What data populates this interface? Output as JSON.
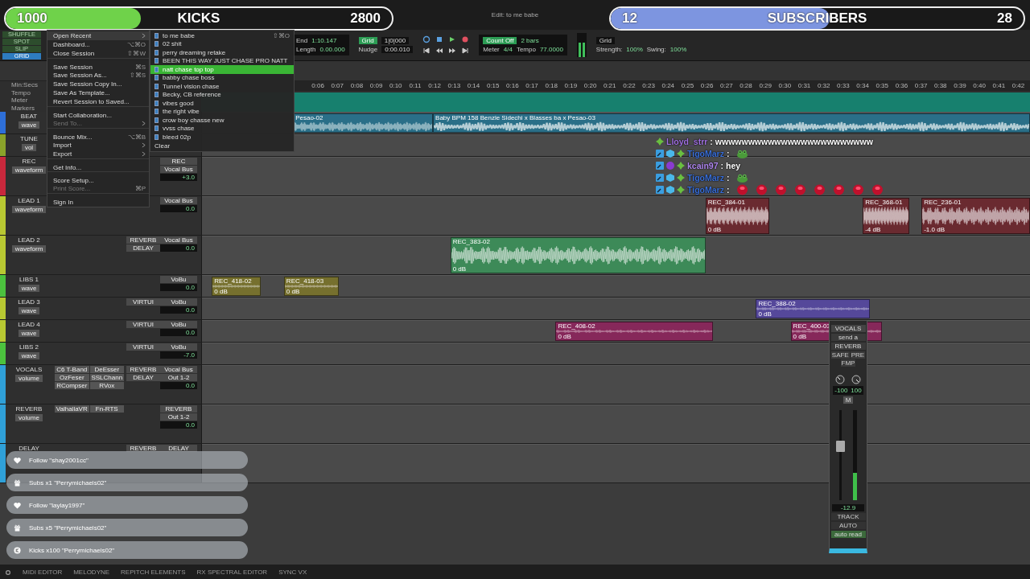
{
  "window": {
    "title": "Edit: to me babe"
  },
  "banners": [
    {
      "current": "1000",
      "label": "KICKS",
      "goal": "2800",
      "level": 0.35,
      "color": "#6fd24a"
    },
    {
      "current": "12",
      "label": "SUBSCRIBERS",
      "goal": "28",
      "level": 0.53,
      "color": "#7d95e0"
    }
  ],
  "edit_modes": [
    {
      "label": "SHUFFLE",
      "selected": false
    },
    {
      "label": "SPOT",
      "selected": false
    },
    {
      "label": "SLIP",
      "selected": false
    },
    {
      "label": "GRID",
      "selected": true
    }
  ],
  "rulers": [
    "Min:Secs",
    "Tempo",
    "Meter",
    "Markers"
  ],
  "toolbar": {
    "counters": [
      {
        "label": "End",
        "value": "1:10.147"
      },
      {
        "label": "Length",
        "value": "0.00.000"
      }
    ],
    "grid": {
      "label": "Grid",
      "value": "1|0|000"
    },
    "nudge": {
      "label": "Nudge",
      "value": "0:00.010"
    },
    "midi": {
      "count_off": "Count Off",
      "meter_label": "Meter",
      "tempo_label": "Tempo",
      "bars": "2 bars",
      "meter": "4/4",
      "tempo": "77.0000"
    },
    "quantize": {
      "grid": "Grid",
      "strength_label": "Strength:",
      "strength": "100%",
      "swing_label": "Swing:",
      "swing": "100%"
    }
  },
  "ruler": [
    "0:06",
    "0:07",
    "0:08",
    "0:09",
    "0:10",
    "0:11",
    "0:12",
    "0:13",
    "0:14",
    "0:15",
    "0:16",
    "0:17",
    "0:18",
    "0:19",
    "0:20",
    "0:21",
    "0:22",
    "0:23",
    "0:24",
    "0:25",
    "0:26",
    "0:27",
    "0:28",
    "0:29",
    "0:30",
    "0:31",
    "0:32",
    "0:33",
    "0:34",
    "0:35",
    "0:36",
    "0:37",
    "0:38",
    "0:39",
    "0:40",
    "0:41",
    "0:42"
  ],
  "tracks": [
    {
      "name": "BEAT",
      "color": "#2e6fd8",
      "expanded": false,
      "view": "wave",
      "clips": [
        {
          "name": "Pesao-02",
          "color": "#2a6f88"
        },
        {
          "name": "Baby BPM 158 Benzie Sidechi x Blasses ba x Pesao-03",
          "color": "#2a6f88"
        }
      ]
    },
    {
      "name": "TUNE",
      "color": "#8aa22a",
      "expanded": false,
      "view": "vol"
    },
    {
      "name": "REC",
      "color": "#c8283c",
      "expanded": true,
      "view": "waveform",
      "io": [
        "REC",
        "Vocal Bus"
      ],
      "vol": "+3.0"
    },
    {
      "name": "LEAD 1",
      "color": "#b8c832",
      "expanded": true,
      "view": "waveform",
      "io": [
        "Vocal Bus"
      ],
      "vol": "0.0",
      "clips": [
        {
          "name": "REC_384-01",
          "color": "#6a2a30",
          "gain": "0 dB"
        },
        {
          "name": "REC_368-01",
          "color": "#6a2a30",
          "gain": "-4 dB"
        },
        {
          "name": "REC_236-01",
          "color": "#6a2a30",
          "gain": "-1.0 dB"
        }
      ]
    },
    {
      "name": "LEAD 2",
      "color": "#b8c832",
      "expanded": true,
      "view": "waveform",
      "sends": [
        "REVERB",
        "DELAY"
      ],
      "io": [
        "Vocal Bus"
      ],
      "vol": "0.0",
      "clips": [
        {
          "name": "REC_383-02",
          "color": "#3d8a58",
          "gain": "0 dB"
        }
      ]
    },
    {
      "name": "LIBS 1",
      "color": "#4cc23e",
      "expanded": false,
      "view": "wave",
      "io": [
        "VoBu"
      ],
      "vol": "0.0",
      "clips": [
        {
          "name": "REC_418-02",
          "color": "#76702e",
          "gain": "0 dB"
        },
        {
          "name": "REC_418-03",
          "color": "#76702e",
          "gain": "0 dB"
        }
      ]
    },
    {
      "name": "LEAD 3",
      "color": "#b8c832",
      "expanded": false,
      "view": "wave",
      "sends": [
        "VIRTUI"
      ],
      "io": [
        "VoBu"
      ],
      "vol": "0.0",
      "clips": [
        {
          "name": "REC_388-02",
          "color": "#55489a",
          "gain": "0 dB"
        }
      ]
    },
    {
      "name": "LEAD 4",
      "color": "#b8c832",
      "expanded": false,
      "view": "wave",
      "sends": [
        "VIRTUI"
      ],
      "io": [
        "VoBu"
      ],
      "vol": "0.0",
      "clips": [
        {
          "name": "REC_408-02",
          "color": "#86285a",
          "gain": "0 dB"
        },
        {
          "name": "REC_400-03",
          "color": "#86285a",
          "gain": "0 dB"
        }
      ]
    },
    {
      "name": "LIBS 2",
      "color": "#4cc23e",
      "expanded": false,
      "view": "wave",
      "sends": [
        "VIRTUI"
      ],
      "io": [
        "VoBu"
      ],
      "vol": "-7.0"
    },
    {
      "name": "VOCALS",
      "color": "#2fa0d8",
      "expanded": true,
      "view": "volume",
      "inserts": [
        "C6 T-Band",
        "DeEsser",
        "OzFeser",
        "SSLChann",
        "RCompser",
        "RVox"
      ],
      "sends": [
        "REVERB",
        "DELAY"
      ],
      "io": [
        "Vocal Bus",
        "Out 1-2"
      ],
      "vol": "0.0"
    },
    {
      "name": "REVERB",
      "color": "#2fa0d8",
      "expanded": true,
      "view": "volume",
      "inserts": [
        "ValhallaVR",
        "Fn-RTS"
      ],
      "io": [
        "REVERB",
        "Out 1-2"
      ],
      "vol": "0.0"
    },
    {
      "name": "DELAY",
      "color": "#2fa0d8",
      "expanded": true,
      "sends": [
        "REVERB"
      ],
      "io": [
        "DELAY"
      ]
    }
  ],
  "file_menu": [
    {
      "label": "Open Recent",
      "submenu": true,
      "disabled": false,
      "group_start": false,
      "selected": true
    },
    {
      "label": "Dashboard...",
      "shortcut": "⌥⌘O",
      "submenu": false,
      "disabled": false,
      "group_start": false,
      "selected": false
    },
    {
      "label": "Close Session",
      "shortcut": "⇧⌘W",
      "submenu": false,
      "disabled": false,
      "group_start": false,
      "selected": false
    },
    {
      "label": "Save Session",
      "shortcut": "⌘S",
      "submenu": false,
      "disabled": false,
      "group_start": true,
      "selected": false
    },
    {
      "label": "Save Session As...",
      "shortcut": "⇧⌘S",
      "submenu": false,
      "disabled": false,
      "group_start": false,
      "selected": false
    },
    {
      "label": "Save Session Copy In...",
      "submenu": false,
      "disabled": false,
      "group_start": false,
      "selected": false
    },
    {
      "label": "Save As Template...",
      "submenu": false,
      "disabled": false,
      "group_start": false,
      "selected": false
    },
    {
      "label": "Revert Session to Saved...",
      "submenu": false,
      "disabled": false,
      "group_start": false,
      "selected": false
    },
    {
      "label": "Start Collaboration...",
      "submenu": false,
      "disabled": false,
      "group_start": true,
      "selected": false
    },
    {
      "label": "Send To...",
      "submenu": true,
      "disabled": true,
      "group_start": false,
      "selected": false
    },
    {
      "label": "Bounce Mix...",
      "shortcut": "⌥⌘B",
      "submenu": false,
      "disabled": false,
      "group_start": true,
      "selected": false
    },
    {
      "label": "Import",
      "submenu": true,
      "disabled": false,
      "group_start": false,
      "selected": false
    },
    {
      "label": "Export",
      "submenu": true,
      "disabled": false,
      "group_start": false,
      "selected": false
    },
    {
      "label": "Get Info...",
      "submenu": false,
      "disabled": false,
      "group_start": true,
      "selected": false
    },
    {
      "label": "Score Setup...",
      "submenu": false,
      "disabled": false,
      "group_start": true,
      "selected": false
    },
    {
      "label": "Print Score...",
      "shortcut": "⌘P",
      "submenu": false,
      "disabled": true,
      "group_start": false,
      "selected": false
    },
    {
      "label": "Sign In",
      "submenu": false,
      "disabled": false,
      "group_start": true,
      "selected": false
    }
  ],
  "recent_menu": {
    "shortcut": "⇧⌘O",
    "items": [
      {
        "label": "to me babe",
        "selected": false
      },
      {
        "label": "02 shit",
        "selected": false
      },
      {
        "label": "perry dreaming retake",
        "selected": false
      },
      {
        "label": "BEEN THIS WAY JUST CHASE  PRO NATT",
        "selected": false
      },
      {
        "label": "natt chase top top",
        "selected": true
      },
      {
        "label": "babby chase boss",
        "selected": false
      },
      {
        "label": "Tunnel vision chase",
        "selected": false
      },
      {
        "label": "Becky, CB reference",
        "selected": false
      },
      {
        "label": "vibes good",
        "selected": false
      },
      {
        "label": "the right vibe",
        "selected": false
      },
      {
        "label": "crow boy chasse new",
        "selected": false
      },
      {
        "label": "vvss chase",
        "selected": false
      },
      {
        "label": "bleed 02p",
        "selected": false
      }
    ],
    "clear": "Clear"
  },
  "chat": [
    {
      "badges": [
        {
          "kind": "diamond"
        }
      ],
      "user": "Lloyd_strr",
      "separator": ":",
      "color": "#a070e0",
      "parts": [
        {
          "kind": "text",
          "text": "wwwwwwwwwwwwwwwwwwwwwwww"
        }
      ]
    },
    {
      "badges": [
        {
          "kind": "wrench"
        },
        {
          "kind": "cube"
        },
        {
          "kind": "diamond"
        }
      ],
      "user": "TigoMarz",
      "separator": ":",
      "color": "#3a6fd8",
      "parts": [
        {
          "kind": "frog"
        }
      ]
    },
    {
      "badges": [
        {
          "kind": "wrench"
        },
        {
          "kind": "orb"
        },
        {
          "kind": "diamond"
        }
      ],
      "user": "kcain97",
      "separator": ":",
      "color": "#b088f0",
      "parts": [
        {
          "kind": "text",
          "text": "hey"
        }
      ]
    },
    {
      "badges": [
        {
          "kind": "wrench"
        },
        {
          "kind": "cube"
        },
        {
          "kind": "diamond"
        }
      ],
      "user": "TigoMarz",
      "separator": ":",
      "color": "#3a6fd8",
      "parts": [
        {
          "kind": "frog"
        }
      ]
    },
    {
      "badges": [
        {
          "kind": "wrench"
        },
        {
          "kind": "cube"
        },
        {
          "kind": "diamond"
        }
      ],
      "user": "TigoMarz",
      "separator": ":",
      "color": "#3a6fd8",
      "parts": [
        {
          "kind": "button"
        },
        {
          "kind": "button"
        },
        {
          "kind": "button"
        },
        {
          "kind": "button"
        },
        {
          "kind": "button"
        },
        {
          "kind": "button"
        },
        {
          "kind": "button"
        },
        {
          "kind": "button"
        }
      ]
    }
  ],
  "alerts": [
    {
      "kind": "follow",
      "text": "Follow \"shay2001cc\""
    },
    {
      "kind": "sub",
      "text": "Subs x1 \"Perrymichaels02\""
    },
    {
      "kind": "follow",
      "text": "Follow \"laylay1997\""
    },
    {
      "kind": "sub",
      "text": "Subs x5 \"Perrymichaels02\""
    },
    {
      "kind": "kick",
      "text": "Kicks x100 \"Perrymichaels02\""
    }
  ],
  "mixer_strip": {
    "track": "VOCALS",
    "send": "send a",
    "send_target": "REVERB",
    "buttons": [
      "SAFE",
      "PRE",
      "FMP"
    ],
    "pan": [
      "-100",
      "100"
    ],
    "mute": "M",
    "fader": {
      "level": 0.6
    },
    "meter": {
      "level": 0.3
    },
    "readout": "-12.9",
    "track_label": "TRACK",
    "auto_label": "AUTO",
    "auto_mode": "auto read"
  },
  "bottom_tabs": [
    "MIDI EDITOR",
    "MELODYNE",
    "REPITCH ELEMENTS",
    "RX SPECTRAL EDITOR",
    "SYNC VX"
  ]
}
